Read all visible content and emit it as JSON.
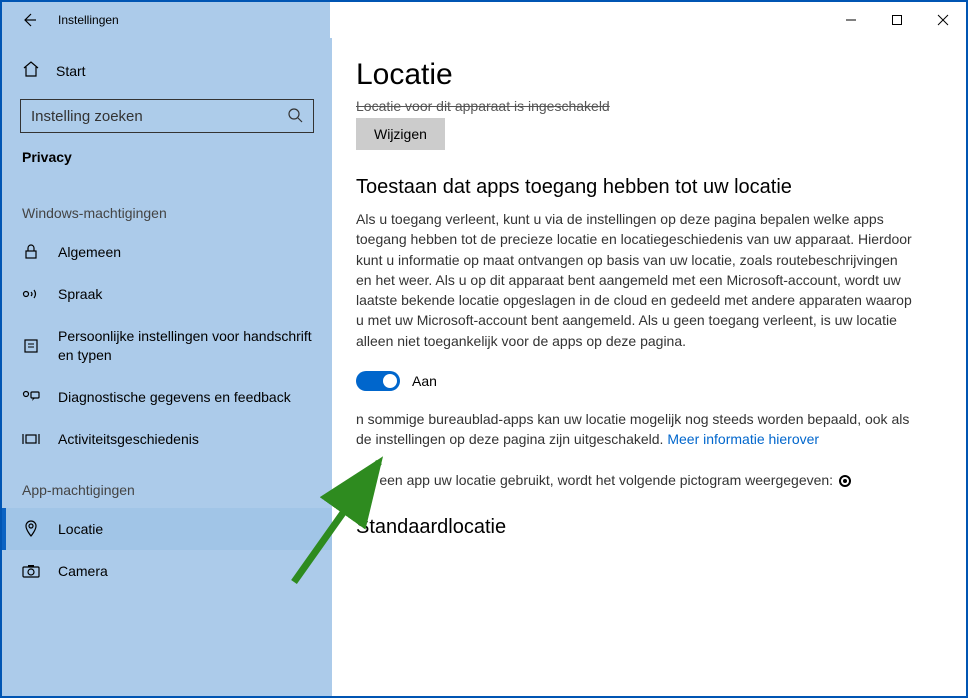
{
  "window": {
    "title": "Instellingen"
  },
  "sidebar": {
    "home": "Start",
    "search_placeholder": "Instelling zoeken",
    "category": "Privacy",
    "section_windows": "Windows-machtigingen",
    "section_app": "App-machtigingen",
    "items_windows": {
      "general": "Algemeen",
      "speech": "Spraak",
      "inking": "Persoonlijke instellingen voor handschrift en typen",
      "diagnostics": "Diagnostische gegevens en feedback",
      "activity": "Activiteitsgeschiedenis"
    },
    "items_app": {
      "location": "Locatie",
      "camera": "Camera"
    }
  },
  "content": {
    "page_title": "Locatie",
    "device_status_truncated": "Locatie voor dit apparaat is ingeschakeld",
    "change_label": "Wijzigen",
    "allow_heading": "Toestaan dat apps toegang hebben tot uw locatie",
    "allow_body": "Als u toegang verleent, kunt u via de instellingen op deze pagina bepalen welke apps toegang hebben tot de precieze locatie en locatiegeschiedenis van uw apparaat. Hierdoor kunt u informatie op maat ontvangen op basis van uw locatie, zoals routebeschrijvingen en het weer. Als u op dit apparaat bent aangemeld met een Microsoft-account, wordt uw laatste bekende locatie opgeslagen in de cloud en gedeeld met andere apparaten waarop u met uw Microsoft-account bent aangemeld. Als u geen toegang verleent, is uw locatie alleen niet toegankelijk voor de apps op deze pagina.",
    "toggle_label": "Aan",
    "desktop_note_part1": "n sommige bureaublad-apps kan uw locatie mogelijk nog steeds worden bepaald, ook als de instellingen op deze pagina zijn uitgeschakeld. ",
    "desktop_note_link": "Meer informatie hierover",
    "indicator_text": "Als een app uw locatie gebruikt, wordt het volgende pictogram weergegeven: ",
    "default_location_heading": "Standaardlocatie"
  }
}
